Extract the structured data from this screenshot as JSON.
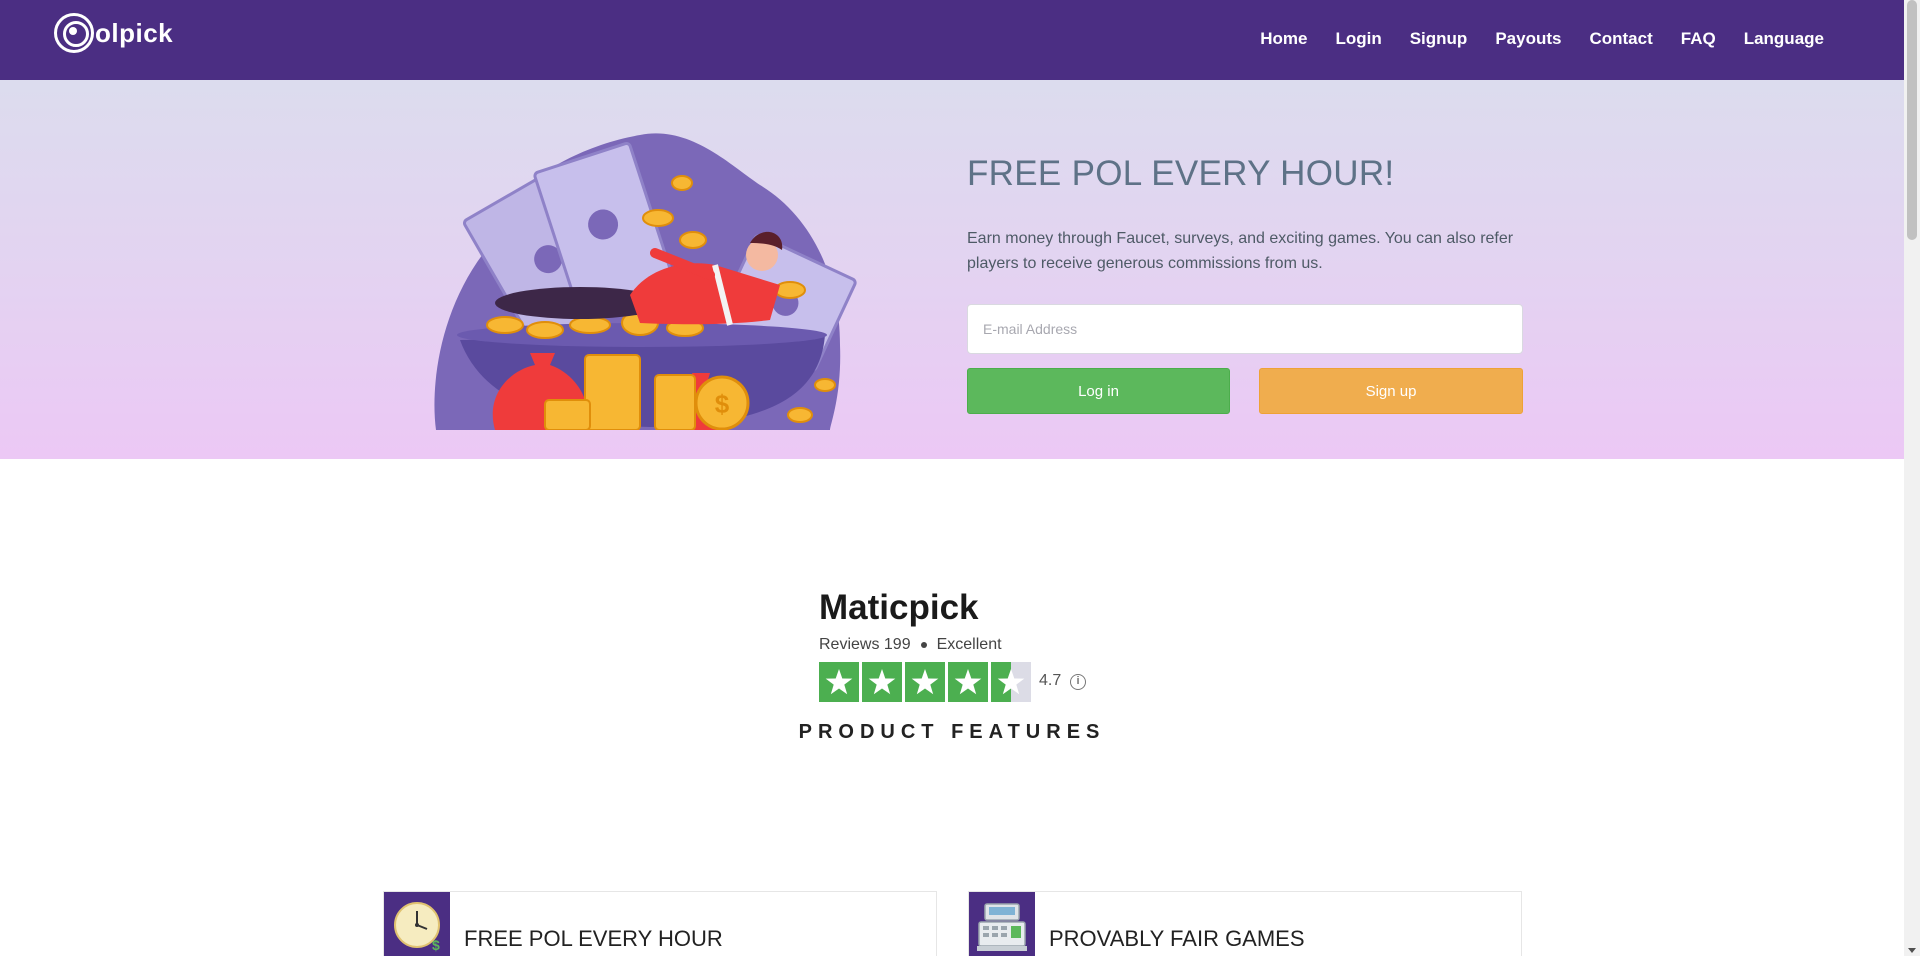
{
  "brand": {
    "logo_text": "olpick",
    "icon": "polpick-logo-icon"
  },
  "nav": {
    "items": [
      {
        "label": "Home"
      },
      {
        "label": "Login"
      },
      {
        "label": "Signup"
      },
      {
        "label": "Payouts"
      },
      {
        "label": "Contact"
      },
      {
        "label": "FAQ"
      },
      {
        "label": "Language"
      }
    ]
  },
  "hero": {
    "title": "FREE POL EVERY HOUR!",
    "description": "Earn money through Faucet, surveys, and exciting games. You can also refer players to receive generous commissions from us.",
    "email_placeholder": "E-mail Address",
    "email_value": "",
    "login_label": "Log in",
    "signup_label": "Sign up",
    "illustration": "man-relaxing-on-money-illustration"
  },
  "reviews": {
    "brand_name": "Maticpick",
    "reviews_text": "Reviews 199",
    "verdict": "Excellent",
    "rating": "4.7",
    "stars_filled": 4.5,
    "stars_total": 5,
    "star_color": "#4caf50",
    "empty_star_color": "#dcdce6"
  },
  "features": {
    "heading": "PRODUCT FEATURES",
    "cards": [
      {
        "title": "FREE POL EVERY HOUR",
        "icon": "clock-icon"
      },
      {
        "title": "PROVABLY FAIR GAMES",
        "icon": "cash-register-icon"
      }
    ]
  },
  "colors": {
    "nav_bg": "#4b2e83",
    "login_btn": "#5cb85c",
    "signup_btn": "#f0ad4e"
  }
}
